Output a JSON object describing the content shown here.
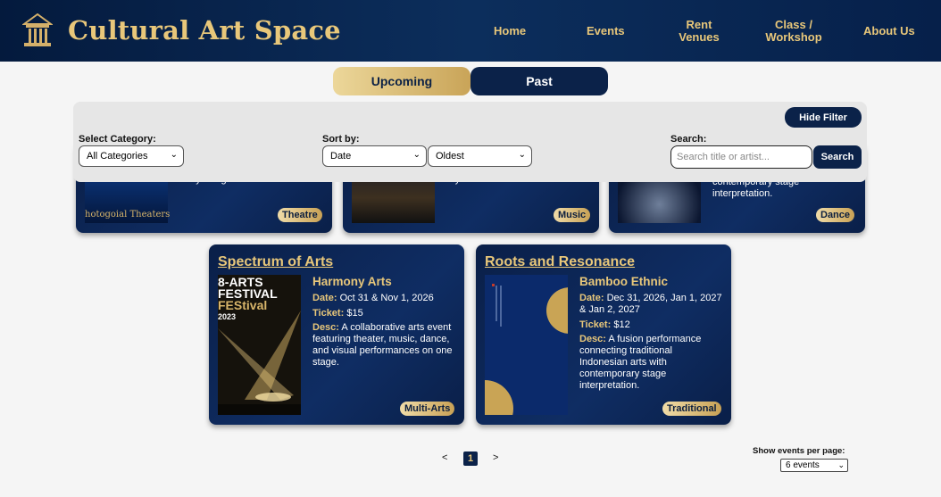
{
  "brand": {
    "name": "Cultural Art Space"
  },
  "nav": {
    "home": "Home",
    "events": "Events",
    "rent_line1": "Rent",
    "rent_line2": "Venues",
    "class_line1": "Class /",
    "class_line2": "Workshop",
    "about": "About Us"
  },
  "tabs": {
    "upcoming": "Upcoming",
    "past": "Past"
  },
  "filter": {
    "hide_label": "Hide Filter",
    "category_label": "Select Category:",
    "category_value": "All Categories",
    "sort_label": "Sort by:",
    "sort_field_value": "Date",
    "sort_order_value": "Oldest",
    "search_label": "Search:",
    "search_placeholder": "Search title or artist...",
    "search_button": "Search"
  },
  "top_cards": [
    {
      "fragment": "storytelling.",
      "poster_text": "hotogoial Theaters",
      "badge": "Theatre"
    },
    {
      "fragment": "rhythm of urban life.",
      "badge": "Music"
    },
    {
      "fragment": "contemporary stage interpretation.",
      "badge": "Dance"
    }
  ],
  "cards": [
    {
      "title": "Spectrum of Arts",
      "poster_line1": "8-ARTS",
      "poster_line2": "FESTIVAL",
      "poster_line3": "FEStival",
      "poster_year": "2023",
      "event_name": "Harmony Arts",
      "date_label": "Date:",
      "date": "Oct 31 & Nov 1, 2026",
      "ticket_label": "Ticket:",
      "ticket": "$15",
      "desc_label": "Desc:",
      "desc": "A collaborative arts event featuring theater, music, dance, and visual performances on one stage.",
      "badge": "Multi-Arts"
    },
    {
      "title": "Roots and Resonance",
      "event_name": "Bamboo Ethnic",
      "date_label": "Date:",
      "date": "Dec 31, 2026, Jan 1, 2027 & Jan 2, 2027",
      "ticket_label": "Ticket:",
      "ticket": "$12",
      "desc_label": "Desc:",
      "desc": "A fusion performance connecting traditional Indonesian arts with contemporary stage interpretation.",
      "badge": "Traditional"
    }
  ],
  "pagination": {
    "prev": "<",
    "current": "1",
    "next": ">"
  },
  "per_page": {
    "label": "Show events per page:",
    "value": "6 events"
  },
  "colors": {
    "navy": "#0b2249",
    "gold": "#e8c77a"
  }
}
